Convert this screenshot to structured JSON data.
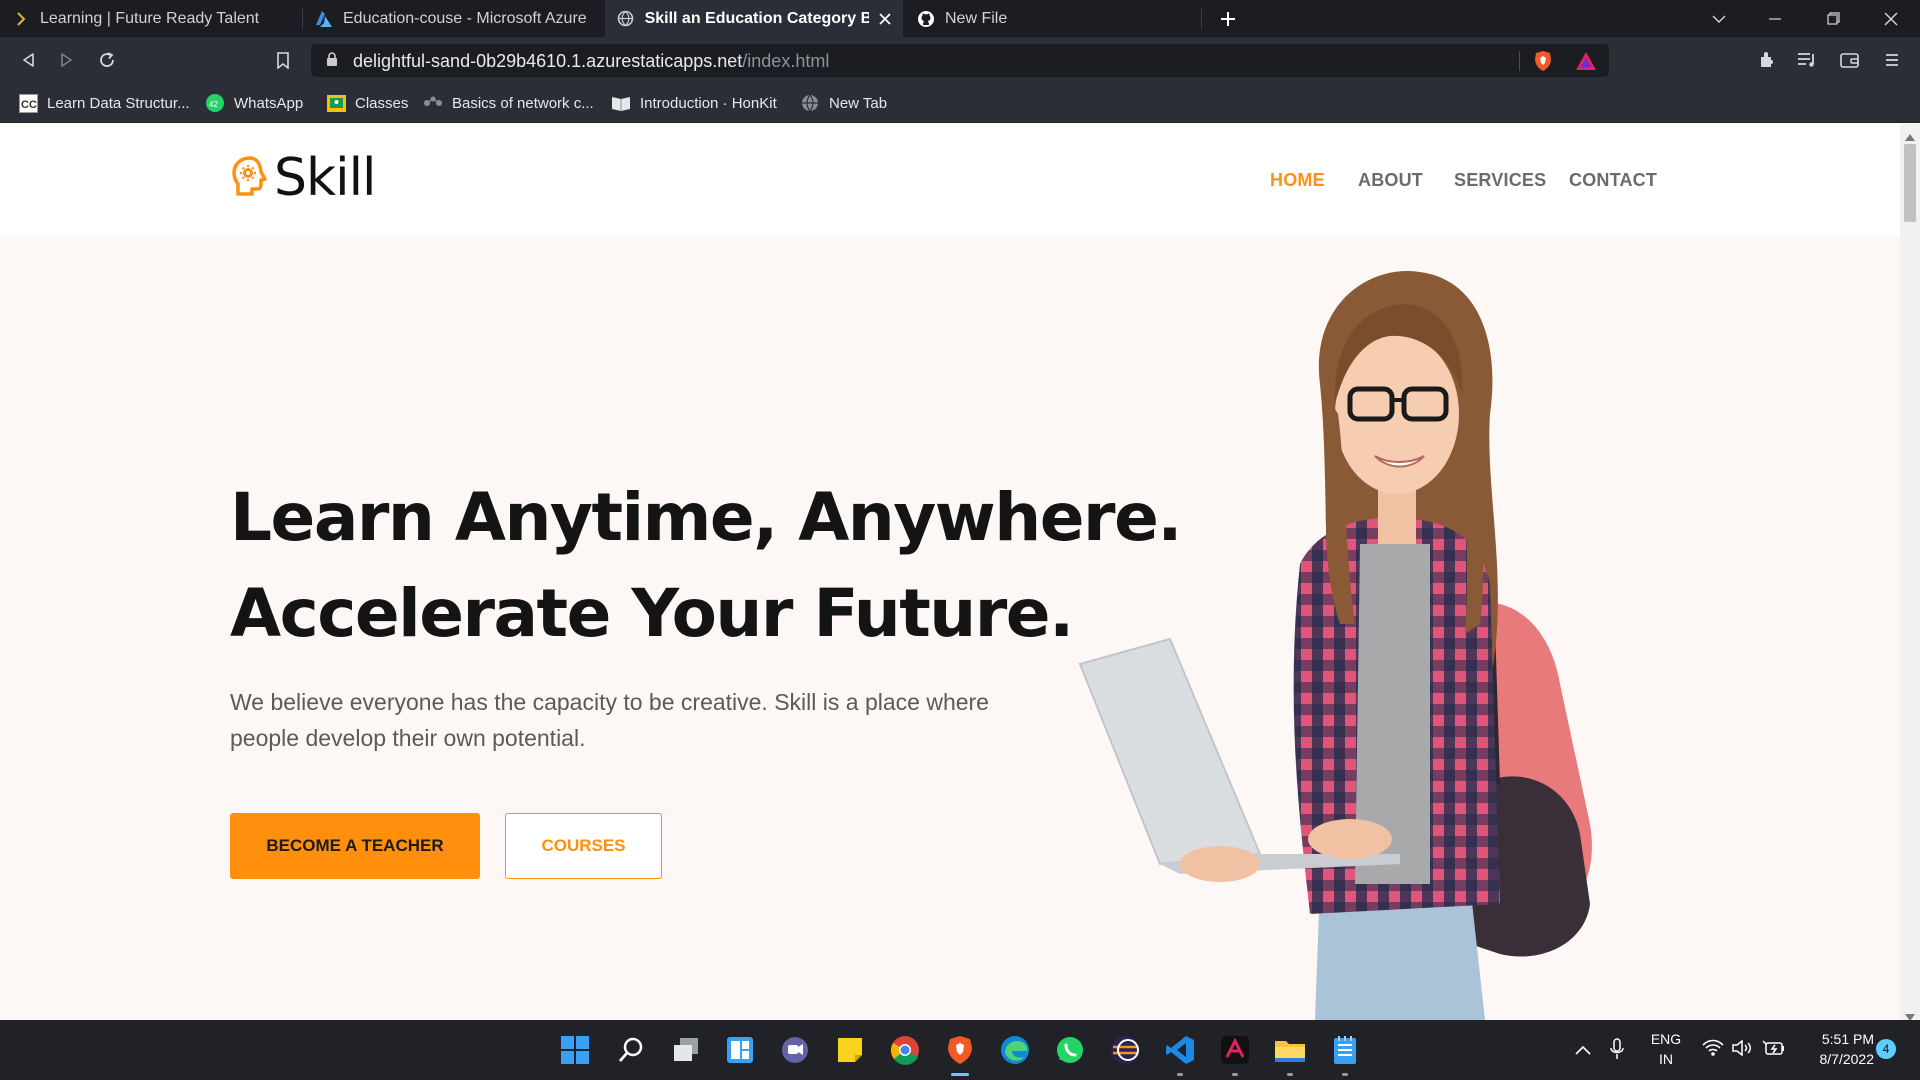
{
  "browser": {
    "tabs": [
      {
        "label": "Learning | Future Ready Talent",
        "icon": "dark-favicon",
        "active": false
      },
      {
        "label": "Education-couse - Microsoft Azure",
        "icon": "azure-icon",
        "active": false
      },
      {
        "label": "Skill an Education Category Boots",
        "icon": "globe-icon",
        "active": true
      },
      {
        "label": "New File",
        "icon": "github-icon",
        "active": false
      }
    ],
    "url_host": "delightful-sand-0b29b4610.1.azurestaticapps.net",
    "url_path": "/index.html",
    "bookmarks": [
      {
        "label": "Learn Data Structur...",
        "icon": "cc-icon"
      },
      {
        "label": "WhatsApp",
        "icon": "whatsapp-icon",
        "badge": "42"
      },
      {
        "label": "Classes",
        "icon": "classroom-icon"
      },
      {
        "label": "Basics of network c...",
        "icon": "network-icon"
      },
      {
        "label": "Introduction · HonKit",
        "icon": "book-icon"
      },
      {
        "label": "New Tab",
        "icon": "globe-icon"
      }
    ]
  },
  "site": {
    "brand": "Skill",
    "nav": [
      {
        "label": "HOME",
        "active": true
      },
      {
        "label": "ABOUT",
        "active": false
      },
      {
        "label": "SERVICES",
        "active": false
      },
      {
        "label": "CONTACT",
        "active": false
      }
    ],
    "hero": {
      "line1": "Learn Anytime, Anywhere.",
      "line2": "Accelerate Your Future.",
      "paragraph": "We believe everyone has the capacity to be creative. Skill is a place where people develop their own potential.",
      "primary_button": "BECOME A TEACHER",
      "secondary_button": "COURSES"
    },
    "accent_color": "#ff8f0c"
  },
  "taskbar": {
    "apps": [
      "windows-start-icon",
      "search-icon",
      "task-view-icon",
      "widgets-icon",
      "teams-chat-icon",
      "sticky-notes-icon",
      "chrome-icon",
      "brave-icon",
      "edge-icon",
      "whatsapp-icon",
      "eclipse-icon",
      "vscode-icon",
      "app-icon",
      "file-explorer-icon",
      "notepad-icon"
    ],
    "language_top": "ENG",
    "language_bottom": "IN",
    "time": "5:51 PM",
    "date": "8/7/2022",
    "notification_count": "4"
  }
}
